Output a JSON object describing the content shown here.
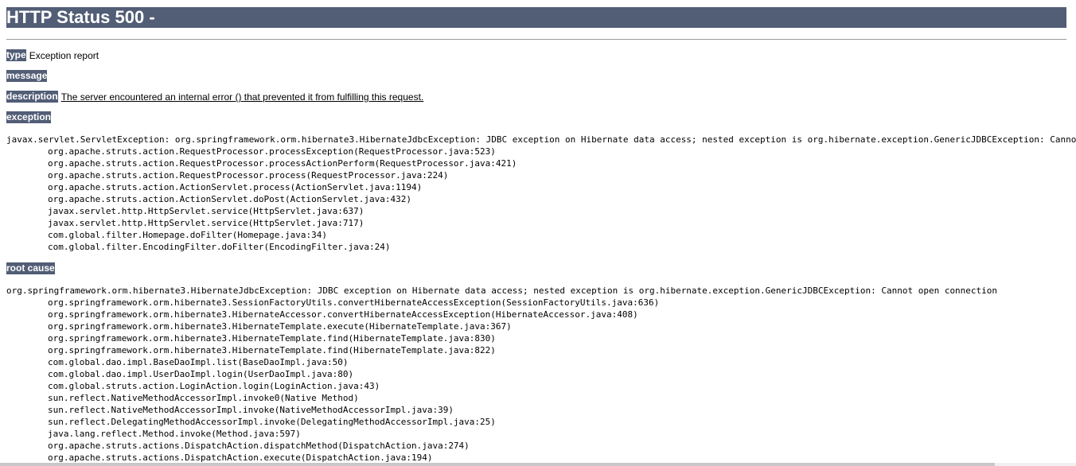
{
  "header": {
    "title": "HTTP Status 500 -"
  },
  "report": {
    "type_label": "type",
    "type_value": "Exception report",
    "message_label": "message",
    "message_value": "",
    "description_label": "description",
    "description_value": "The server encountered an internal error () that prevented it from fulfilling this request.",
    "exception_label": "exception",
    "root_cause_label": "root cause"
  },
  "exception_trace": {
    "first_line": "javax.servlet.ServletException: org.springframework.orm.hibernate3.HibernateJdbcException: JDBC exception on Hibernate data access; nested exception is org.hibernate.exception.GenericJDBCException: Cannot op",
    "frames": [
      "org.apache.struts.action.RequestProcessor.processException(RequestProcessor.java:523)",
      "org.apache.struts.action.RequestProcessor.processActionPerform(RequestProcessor.java:421)",
      "org.apache.struts.action.RequestProcessor.process(RequestProcessor.java:224)",
      "org.apache.struts.action.ActionServlet.process(ActionServlet.java:1194)",
      "org.apache.struts.action.ActionServlet.doPost(ActionServlet.java:432)",
      "javax.servlet.http.HttpServlet.service(HttpServlet.java:637)",
      "javax.servlet.http.HttpServlet.service(HttpServlet.java:717)",
      "com.global.filter.Homepage.doFilter(Homepage.java:34)",
      "com.global.filter.EncodingFilter.doFilter(EncodingFilter.java:24)"
    ]
  },
  "root_cause_trace": {
    "first_line": "org.springframework.orm.hibernate3.HibernateJdbcException: JDBC exception on Hibernate data access; nested exception is org.hibernate.exception.GenericJDBCException: Cannot open connection",
    "frames": [
      "org.springframework.orm.hibernate3.SessionFactoryUtils.convertHibernateAccessException(SessionFactoryUtils.java:636)",
      "org.springframework.orm.hibernate3.HibernateAccessor.convertHibernateAccessException(HibernateAccessor.java:408)",
      "org.springframework.orm.hibernate3.HibernateTemplate.execute(HibernateTemplate.java:367)",
      "org.springframework.orm.hibernate3.HibernateTemplate.find(HibernateTemplate.java:830)",
      "org.springframework.orm.hibernate3.HibernateTemplate.find(HibernateTemplate.java:822)",
      "com.global.dao.impl.BaseDaoImpl.list(BaseDaoImpl.java:50)",
      "com.global.dao.impl.UserDaoImpl.login(UserDaoImpl.java:80)",
      "com.global.struts.action.LoginAction.login(LoginAction.java:43)",
      "sun.reflect.NativeMethodAccessorImpl.invoke0(Native Method)",
      "sun.reflect.NativeMethodAccessorImpl.invoke(NativeMethodAccessorImpl.java:39)",
      "sun.reflect.DelegatingMethodAccessorImpl.invoke(DelegatingMethodAccessorImpl.java:25)",
      "java.lang.reflect.Method.invoke(Method.java:597)",
      "org.apache.struts.actions.DispatchAction.dispatchMethod(DispatchAction.java:274)",
      "org.apache.struts.actions.DispatchAction.execute(DispatchAction.java:194)"
    ]
  },
  "colors": {
    "header_bg": "#525D76",
    "header_text": "#ffffff"
  }
}
